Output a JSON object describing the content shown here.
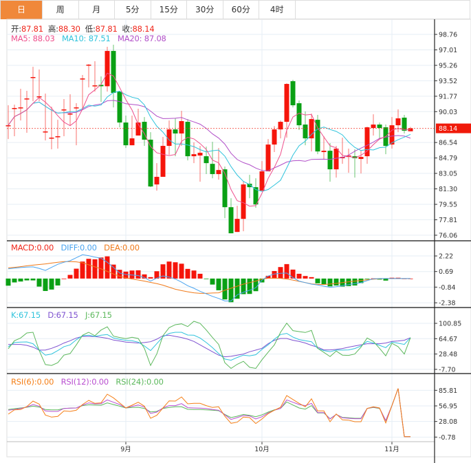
{
  "tabs": [
    "日",
    "周",
    "月",
    "5分",
    "15分",
    "30分",
    "60分",
    "4时"
  ],
  "active_tab": 0,
  "ohlc_legend": {
    "open_label": "开:",
    "open": "87.81",
    "high_label": "高:",
    "high": "88.30",
    "low_label": "低:",
    "low": "87.81",
    "close_label": "收:",
    "close": "88.14"
  },
  "ma_legend": {
    "ma5": "MA5: 88.03",
    "ma10": "MA10: 87.51",
    "ma20": "MA20: 87.08"
  },
  "macd_legend": {
    "macd": "MACD:0.00",
    "diff": "DIFF:0.00",
    "dea": "DEA:0.00"
  },
  "kdj_legend": {
    "k": "K:67.15",
    "d": "D:67.15",
    "j": "J:67.15"
  },
  "rsi_legend": {
    "rsi6": "RSI(6):0.00",
    "rsi12": "RSI(12):0.00",
    "rsi24": "RSI(24):0.00"
  },
  "colors": {
    "up": "#f5150b",
    "down": "#0aa014",
    "ma5": "#ee4f8c",
    "ma10": "#2fc3dc",
    "ma20": "#b14fc8",
    "diff": "#4aa4f0",
    "dea": "#f07a1a",
    "k": "#2fc3dc",
    "d": "#7e52d0",
    "j": "#5cb85c",
    "rsi6": "#f57f17",
    "rsi12": "#b94fd0",
    "rsi24": "#5cb85c",
    "tab_active": "#f0883a"
  },
  "chart_data": {
    "type": "candlestick",
    "last_price": "88.14",
    "price_ticks": [
      "98.76",
      "97.01",
      "95.26",
      "93.52",
      "91.77",
      "90.03",
      "86.54",
      "84.79",
      "83.05",
      "81.30",
      "79.55",
      "77.81",
      "76.06"
    ],
    "macd_ticks": [
      "2.22",
      "0.69",
      "-0.84",
      "-2.38"
    ],
    "kdj_ticks": [
      "100.85",
      "64.67",
      "28.48",
      "-7.70"
    ],
    "rsi_ticks": [
      "85.81",
      "56.95",
      "28.08",
      "-0.78"
    ],
    "x_labels": [
      {
        "index": 19,
        "label": "9月"
      },
      {
        "index": 41,
        "label": "10月"
      },
      {
        "index": 62,
        "label": "11月"
      }
    ],
    "candles_ohlc": [
      [
        88.47,
        90.75,
        86.93,
        88.49
      ],
      [
        90.42,
        90.82,
        87.25,
        90.44
      ],
      [
        90.49,
        92.61,
        89.03,
        90.51
      ],
      [
        91.5,
        92.38,
        87.64,
        91.52
      ],
      [
        93.92,
        95.1,
        91.21,
        93.94
      ],
      [
        91.74,
        94.79,
        91.21,
        91.76
      ],
      [
        87.77,
        92.07,
        86.78,
        87.79
      ],
      [
        87.07,
        90.59,
        85.77,
        87.09
      ],
      [
        87.23,
        89.11,
        85.85,
        87.25
      ],
      [
        90.26,
        91.45,
        87.25,
        90.28
      ],
      [
        89.79,
        91.99,
        88.41,
        89.81
      ],
      [
        90.49,
        90.98,
        86.23,
        90.51
      ],
      [
        93.76,
        94.17,
        90.28,
        93.78
      ],
      [
        95.32,
        95.41,
        92.77,
        95.34
      ],
      [
        92.98,
        95.73,
        92.3,
        93.0
      ],
      [
        93.06,
        94.01,
        91.13,
        92.9
      ],
      [
        92.9,
        97.36,
        92.3,
        96.89
      ],
      [
        96.89,
        97.59,
        90.51,
        92.15
      ],
      [
        92.3,
        92.3,
        88.26,
        88.8
      ],
      [
        88.8,
        89.58,
        85.92,
        86.23
      ],
      [
        86.23,
        89.58,
        86.23,
        87.01
      ],
      [
        87.33,
        90.36,
        87.33,
        88.8
      ],
      [
        88.88,
        89.42,
        86.16,
        86.86
      ],
      [
        86.86,
        87.71,
        81.49,
        81.57
      ],
      [
        81.8,
        84.21,
        81.1,
        82.66
      ],
      [
        82.66,
        87.17,
        82.66,
        86.16
      ],
      [
        86.16,
        89.03,
        85.15,
        88.02
      ],
      [
        88.02,
        89.27,
        84.99,
        87.56
      ],
      [
        87.56,
        90.12,
        86.16,
        88.96
      ],
      [
        88.88,
        89.19,
        84.52,
        84.99
      ],
      [
        84.99,
        86.55,
        84.21,
        85.22
      ],
      [
        85.07,
        86.16,
        82.11,
        85.38
      ],
      [
        84.99,
        86.08,
        82.97,
        84.21
      ],
      [
        84.13,
        86.62,
        82.5,
        82.97
      ],
      [
        82.97,
        85.92,
        82.34,
        83.43
      ],
      [
        83.51,
        83.82,
        77.99,
        79.23
      ],
      [
        79.23,
        80.24,
        76.28,
        76.28
      ],
      [
        76.43,
        79.39,
        76.43,
        77.91
      ],
      [
        77.91,
        82.19,
        76.51,
        81.8
      ],
      [
        81.88,
        82.89,
        80.24,
        81.49
      ],
      [
        81.49,
        82.5,
        79.15,
        79.54
      ],
      [
        81.1,
        84.44,
        81.1,
        83.28
      ],
      [
        83.28,
        86.93,
        83.28,
        86.31
      ],
      [
        86.31,
        88.41,
        85.46,
        88.02
      ],
      [
        88.02,
        89.03,
        87.01,
        88.88
      ],
      [
        88.88,
        93.24,
        87.09,
        93.16
      ],
      [
        93.47,
        93.63,
        90.51,
        90.75
      ],
      [
        90.98,
        91.29,
        87.95,
        88.49
      ],
      [
        88.57,
        90.05,
        86.23,
        87.01
      ],
      [
        87.01,
        89.81,
        85.53,
        89.19
      ],
      [
        89.11,
        89.66,
        85.22,
        85.53
      ],
      [
        85.46,
        87.25,
        84.6,
        85.61
      ],
      [
        85.61,
        86.47,
        82.11,
        83.51
      ],
      [
        83.51,
        86.16,
        82.58,
        85.85
      ],
      [
        84.76,
        87.09,
        84.13,
        84.91
      ],
      [
        84.91,
        85.85,
        83.12,
        85.07
      ],
      [
        84.99,
        85.77,
        82.58,
        84.76
      ],
      [
        84.68,
        85.61,
        83.04,
        84.91
      ],
      [
        84.99,
        88.33,
        84.13,
        88.26
      ],
      [
        88.18,
        89.73,
        87.33,
        88.57
      ],
      [
        88.57,
        88.8,
        86.86,
        88.18
      ],
      [
        88.26,
        88.57,
        85.22,
        86.16
      ],
      [
        86.31,
        89.42,
        85.85,
        88.49
      ],
      [
        88.49,
        90.28,
        87.71,
        89.27
      ],
      [
        89.35,
        89.66,
        87.56,
        87.87
      ],
      [
        87.81,
        88.3,
        87.81,
        88.14
      ]
    ],
    "macd": [
      -0.7,
      -0.38,
      -0.29,
      -0.18,
      -0.18,
      -0.79,
      -1.22,
      -1.08,
      -0.68,
      0.0,
      0.36,
      0.97,
      1.67,
      1.94,
      1.89,
      2.07,
      2.18,
      1.37,
      0.86,
      0.68,
      0.79,
      0.81,
      0.41,
      0.14,
      0.72,
      1.4,
      1.67,
      1.6,
      1.46,
      0.95,
      0.79,
      0.47,
      -0.02,
      -0.59,
      -1.15,
      -2.05,
      -2.32,
      -1.98,
      -1.53,
      -1.51,
      -1.24,
      -0.38,
      0.27,
      0.74,
      1.13,
      1.42,
      0.88,
      0.47,
      0.25,
      0.14,
      -0.47,
      -0.59,
      -0.77,
      -0.68,
      -0.79,
      -0.74,
      -0.68,
      -0.45,
      -0.05,
      0.02,
      -0.1,
      -0.2,
      0.08,
      0.08,
      0.0,
      0.0
    ],
    "diff": [
      0.95,
      1.02,
      1.08,
      1.12,
      1.15,
      1.0,
      0.8,
      1.1,
      1.4,
      1.6,
      1.75,
      2.05,
      2.34,
      2.25,
      2.1,
      2.0,
      1.6,
      1.1,
      0.55,
      0.4,
      0.35,
      0.3,
      0.1,
      -0.25,
      0.05,
      0.25,
      0.15,
      -0.05,
      -0.35,
      -0.7,
      -0.95,
      -1.25,
      -1.5,
      -1.75,
      -1.95,
      -2.2,
      -2.2,
      -1.6,
      -1.35,
      -1.15,
      -0.9,
      -0.15,
      0.25,
      0.45,
      0.52,
      0.54,
      0.1,
      -0.25,
      -0.4,
      -0.55,
      -0.63,
      -0.75,
      -0.86,
      -0.8,
      -0.7,
      -0.6,
      -0.5,
      -0.41,
      -0.2,
      -0.02,
      0,
      0,
      0,
      0,
      0,
      0
    ],
    "dea": [
      1.05,
      1.1,
      1.17,
      1.25,
      1.32,
      1.38,
      1.44,
      1.52,
      1.6,
      1.66,
      1.67,
      1.64,
      1.55,
      1.35,
      1.15,
      0.95,
      0.7,
      0.45,
      0.22,
      0.08,
      -0.05,
      -0.14,
      -0.25,
      -0.38,
      -0.5,
      -0.65,
      -0.85,
      -1.05,
      -1.18,
      -1.3,
      -1.4,
      -1.45,
      -1.45,
      -1.42,
      -1.4,
      -1.15,
      -0.95,
      -0.75,
      -0.55,
      -0.4,
      -0.25,
      -0.05,
      0.03,
      0.05,
      0.02,
      -0.05,
      -0.15,
      -0.28,
      -0.4,
      -0.52,
      -0.58,
      -0.58,
      -0.54,
      -0.48,
      -0.4,
      -0.32,
      -0.25,
      -0.18,
      -0.12,
      -0.07,
      -0.03,
      0,
      0,
      0,
      0,
      0
    ],
    "k": [
      45.8,
      55.5,
      56.6,
      57.1,
      52.8,
      38.2,
      25.8,
      28.5,
      36.6,
      45.8,
      50.1,
      62.0,
      71.7,
      72.8,
      70.1,
      72.8,
      74.4,
      66.3,
      63.0,
      60.9,
      59.8,
      56.6,
      47.4,
      36.6,
      52.8,
      69.0,
      77.1,
      79.8,
      79.8,
      73.3,
      72.8,
      66.3,
      55.5,
      43.6,
      29.6,
      16.6,
      13.9,
      20.4,
      25.8,
      24.2,
      26.9,
      39.3,
      50.1,
      63.6,
      74.4,
      77.1,
      68.5,
      62.5,
      59.8,
      57.6,
      42.0,
      36.6,
      33.9,
      37.7,
      37.7,
      38.2,
      41.5,
      47.4,
      58.2,
      54.4,
      49.0,
      43.6,
      56.6,
      53.9,
      51.2,
      67.15
    ],
    "d": [
      51.2,
      51.2,
      51.2,
      49.0,
      44.7,
      37.7,
      37.7,
      42.0,
      47.4,
      54.4,
      59.8,
      66.3,
      70.1,
      70.1,
      69.5,
      67.9,
      65.7,
      61.4,
      59.3,
      56.6,
      55.5,
      54.4,
      55.5,
      57.6,
      63.6,
      71.7,
      72.8,
      70.1,
      67.4,
      63.6,
      58.2,
      50.1,
      42.0,
      33.9,
      25.8,
      22.0,
      23.1,
      25.8,
      28.5,
      33.9,
      37.7,
      42.0,
      52.8,
      60.9,
      65.2,
      65.2,
      60.9,
      58.2,
      54.4,
      49.0,
      44.7,
      38.2,
      38.2,
      39.3,
      41.5,
      44.7,
      47.4,
      50.1,
      52.8,
      52.8,
      52.8,
      54.4,
      58.2,
      59.3,
      60.9,
      67.15
    ],
    "j": [
      40.9,
      59.8,
      66.3,
      78.2,
      79.8,
      36.6,
      3.6,
      1.5,
      8.0,
      25.8,
      29.6,
      50.1,
      72.8,
      79.8,
      71.7,
      85.2,
      92.7,
      70.6,
      67.4,
      64.7,
      67.9,
      65.2,
      42.0,
      1.5,
      28.5,
      71.7,
      90.6,
      97.6,
      99.8,
      93.3,
      105.7,
      100.8,
      85.2,
      67.4,
      51.2,
      8.0,
      -5.5,
      4.2,
      11.2,
      -2.8,
      -5.5,
      15.0,
      32.8,
      50.1,
      79.8,
      101.4,
      83.6,
      81.4,
      79.2,
      84.1,
      42.0,
      32.3,
      22.5,
      35.5,
      25.8,
      25.3,
      28.5,
      44.7,
      66.3,
      58.2,
      42.0,
      24.2,
      53.9,
      45.8,
      28.5,
      67.15
    ],
    "rsi6": [
      41.7,
      49.7,
      50.2,
      55.7,
      65.9,
      60.3,
      40.0,
      36.2,
      37.4,
      47.6,
      46.8,
      48.9,
      59.5,
      67.1,
      61.6,
      62.5,
      78.6,
      71.8,
      62.5,
      53.1,
      58.2,
      63.7,
      56.5,
      34.0,
      39.5,
      53.1,
      66.3,
      65.9,
      73.5,
      60.8,
      61.6,
      61.6,
      57.4,
      54.0,
      55.3,
      37.8,
      24.7,
      26.8,
      36.2,
      35.3,
      24.3,
      32.8,
      42.5,
      48.9,
      54.4,
      76.0,
      68.8,
      61.6,
      55.3,
      70.1,
      47.6,
      47.6,
      27.7,
      42.1,
      31.1,
      30.6,
      27.7,
      27.7,
      52.3,
      55.3,
      53.1,
      25.5,
      57.4,
      89.2,
      0,
      0
    ],
    "rsi12": [
      48.9,
      50.2,
      52.3,
      54.8,
      59.5,
      56.5,
      47.6,
      46.8,
      46.8,
      52.3,
      52.7,
      53.1,
      58.2,
      62.5,
      60.8,
      61.2,
      68.0,
      63.7,
      59.5,
      53.1,
      56.1,
      58.6,
      54.8,
      42.9,
      45.5,
      53.1,
      57.4,
      57.4,
      61.2,
      53.6,
      53.1,
      52.7,
      52.3,
      50.2,
      48.9,
      40.4,
      31.9,
      35.3,
      39.1,
      38.3,
      32.8,
      37.0,
      43.8,
      48.9,
      52.3,
      68.0,
      63.7,
      59.5,
      57.4,
      61.6,
      44.6,
      44.6,
      32.8,
      41.2,
      34.9,
      34.0,
      33.2,
      33.2,
      52.3,
      54.8,
      52.7,
      29.8,
      57.4,
      89.2,
      0,
      0
    ],
    "rsi24": [
      50.2,
      51.9,
      53.1,
      54.4,
      56.5,
      54.8,
      50.2,
      49.7,
      49.7,
      52.3,
      52.7,
      53.1,
      57.4,
      59.1,
      58.6,
      58.2,
      62.5,
      59.5,
      56.5,
      53.1,
      54.0,
      54.4,
      52.3,
      45.9,
      46.8,
      52.3,
      54.0,
      55.3,
      55.3,
      50.6,
      50.2,
      50.2,
      49.7,
      48.9,
      48.0,
      41.2,
      35.3,
      37.8,
      41.2,
      39.5,
      37.0,
      40.4,
      45.5,
      49.7,
      52.3,
      64.2,
      58.6,
      53.1,
      51.0,
      57.4,
      43.8,
      43.8,
      33.2,
      41.2,
      35.7,
      34.9,
      34.0,
      34.0,
      52.3,
      54.0,
      52.3,
      29.8,
      57.4,
      89.2,
      0,
      0
    ]
  }
}
